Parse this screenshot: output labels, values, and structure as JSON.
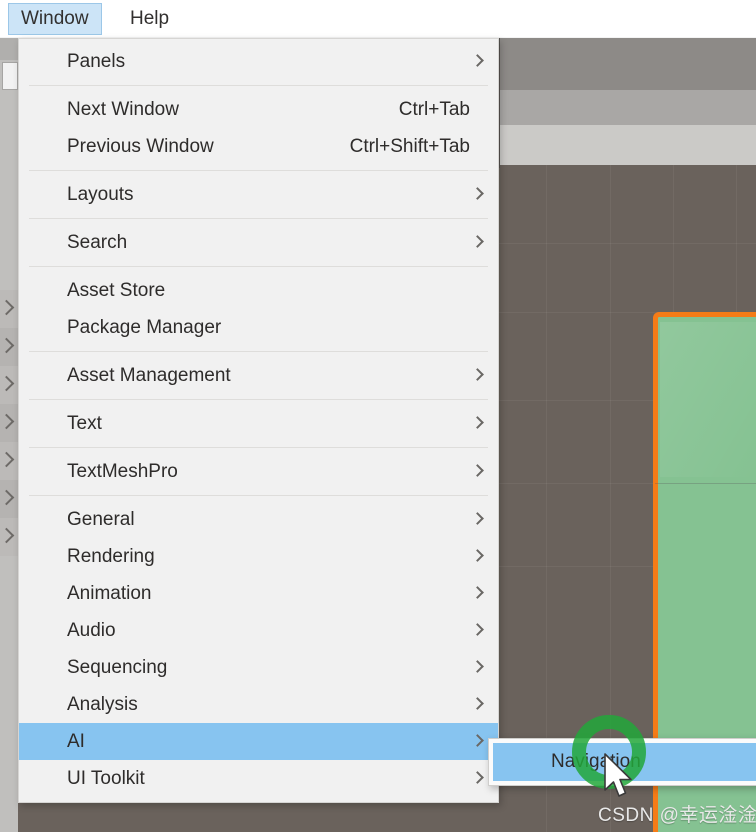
{
  "menubar": {
    "items": [
      {
        "label": "Window",
        "active": true
      },
      {
        "label": "Help",
        "active": false
      }
    ]
  },
  "window_menu": {
    "groups": [
      {
        "items": [
          {
            "label": "Panels",
            "shortcut": "",
            "submenu": true,
            "selected": false
          }
        ]
      },
      {
        "items": [
          {
            "label": "Next Window",
            "shortcut": "Ctrl+Tab",
            "submenu": false,
            "selected": false
          },
          {
            "label": "Previous Window",
            "shortcut": "Ctrl+Shift+Tab",
            "submenu": false,
            "selected": false
          }
        ]
      },
      {
        "items": [
          {
            "label": "Layouts",
            "shortcut": "",
            "submenu": true,
            "selected": false
          }
        ]
      },
      {
        "items": [
          {
            "label": "Search",
            "shortcut": "",
            "submenu": true,
            "selected": false
          }
        ]
      },
      {
        "items": [
          {
            "label": "Asset Store",
            "shortcut": "",
            "submenu": false,
            "selected": false
          },
          {
            "label": "Package Manager",
            "shortcut": "",
            "submenu": false,
            "selected": false
          }
        ]
      },
      {
        "items": [
          {
            "label": "Asset Management",
            "shortcut": "",
            "submenu": true,
            "selected": false
          }
        ]
      },
      {
        "items": [
          {
            "label": "Text",
            "shortcut": "",
            "submenu": true,
            "selected": false
          }
        ]
      },
      {
        "items": [
          {
            "label": "TextMeshPro",
            "shortcut": "",
            "submenu": true,
            "selected": false
          }
        ]
      },
      {
        "items": [
          {
            "label": "General",
            "shortcut": "",
            "submenu": true,
            "selected": false
          },
          {
            "label": "Rendering",
            "shortcut": "",
            "submenu": true,
            "selected": false
          },
          {
            "label": "Animation",
            "shortcut": "",
            "submenu": true,
            "selected": false
          },
          {
            "label": "Audio",
            "shortcut": "",
            "submenu": true,
            "selected": false
          },
          {
            "label": "Sequencing",
            "shortcut": "",
            "submenu": true,
            "selected": false
          },
          {
            "label": "Analysis",
            "shortcut": "",
            "submenu": true,
            "selected": false
          },
          {
            "label": "AI",
            "shortcut": "",
            "submenu": true,
            "selected": true
          },
          {
            "label": "UI Toolkit",
            "shortcut": "",
            "submenu": true,
            "selected": false
          }
        ]
      }
    ]
  },
  "ai_submenu": {
    "items": [
      {
        "label": "Navigation",
        "selected": true
      }
    ]
  },
  "annotations": {
    "watermark": "CSDN @幸运淦淦",
    "click_ring_color": "#22a73a",
    "cursor": "arrow-pointer"
  },
  "colors": {
    "menu_background": "#f1f1f1",
    "menu_highlight": "#87c4f0",
    "menubar_active": "#cce4f7",
    "viewport_background": "#6a625c",
    "selection_outline": "#f57c17",
    "object_fill": "#85c292"
  }
}
